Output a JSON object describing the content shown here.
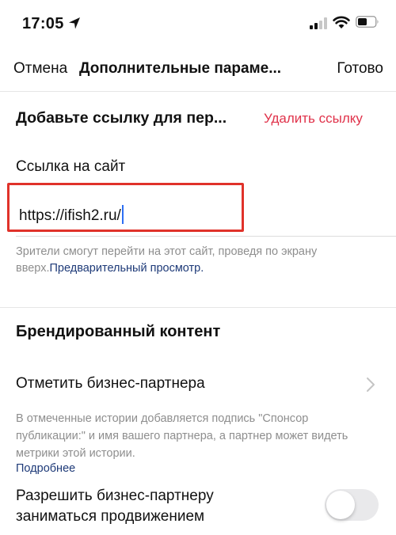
{
  "status_bar": {
    "time": "17:05"
  },
  "nav": {
    "cancel_label": "Отмена",
    "title": "Дополнительные параме...",
    "done_label": "Готово"
  },
  "link_section": {
    "header": "Добавьте ссылку для пер...",
    "delete_label": "Удалить ссылку",
    "field_label": "Ссылка на сайт",
    "url_value": "https://ifish2.ru/",
    "helper_text": "Зрители смогут перейти на этот сайт, проведя по экрану вверх.",
    "preview_link": "Предварительный просмотр."
  },
  "branded_section": {
    "header": "Брендированный контент",
    "tag_partner_label": "Отметить бизнес-партнера",
    "info_text": "В отмеченные истории добавляется подпись \"Спонсор публикации:\" и имя вашего партнера, а партнер может видеть метрики этой истории.",
    "more_link": "Подробнее",
    "allow_promotion_label": "Разрешить бизнес-партнеру заниматься продвижением",
    "allow_promotion_enabled": false
  },
  "colors": {
    "accent_red": "#e0324a",
    "highlight_border": "#e0322a",
    "link_blue": "#1e3a78",
    "secondary_text": "#8e8e8e",
    "cursor_blue": "#2d6ff3"
  },
  "icons": {
    "location": "location-arrow-icon",
    "signal": "cellular-signal-icon",
    "wifi": "wifi-icon",
    "battery": "battery-icon",
    "chevron": "chevron-right-icon"
  }
}
